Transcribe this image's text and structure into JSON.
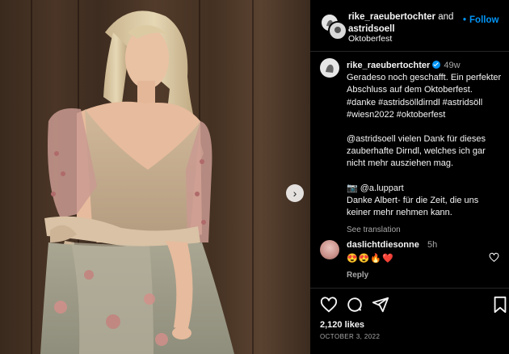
{
  "post": {
    "header": {
      "user1": "rike_raeubertochter",
      "and_text": " and",
      "user2": "astridsoell",
      "location": "Oktoberfest",
      "follow_label": "Follow"
    },
    "caption": {
      "username": "rike_raeubertochter",
      "time": "49w",
      "lines1": [
        "Geradeso noch geschafft. Ein perfekter",
        "Abschluss auf dem Oktoberfest.",
        "#danke #astridsölldirndl #astridsöll",
        "#wiesn2022 #oktoberfest"
      ],
      "lines2": [
        "@astridsoell vielen Dank für dieses",
        "zauberhafte Dirndl, welches ich gar",
        "nicht mehr ausziehen mag."
      ],
      "lines3": [
        "📷 @a.luppart",
        "Danke Albert- für die Zeit, die uns",
        "keiner mehr nehmen kann."
      ],
      "see_translation": "See translation"
    },
    "comment": {
      "username": "daslichtdiesonne",
      "time": "5h",
      "text": "😍😍🔥❤️",
      "reply_label": "Reply"
    },
    "likes": "2,120 likes",
    "date": "OCTOBER 3, 2022"
  },
  "icons": {
    "next": "chevron-right-icon",
    "like": "heart-icon",
    "comment": "comment-icon",
    "share": "paper-plane-icon",
    "save": "bookmark-icon"
  },
  "colors": {
    "background": "#000000",
    "text": "#f5f5f5",
    "secondary": "#a8a8a8",
    "accent": "#0095f6",
    "divider": "#262626"
  }
}
